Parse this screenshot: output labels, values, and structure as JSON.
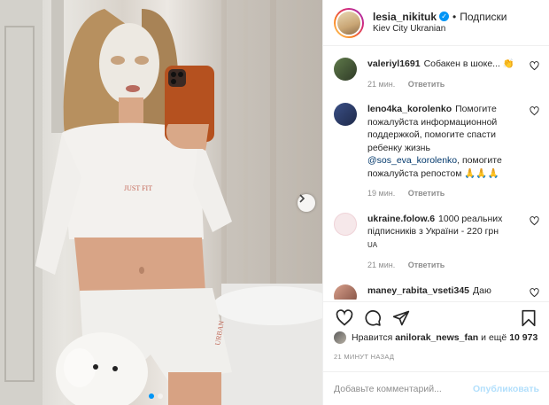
{
  "header": {
    "username": "lesia_nikituk",
    "separator": "•",
    "follow_label": "Подписки",
    "location": "Kiev City Ukranian"
  },
  "comments": [
    {
      "user": "valeriyl1691",
      "text": "Собакен в шоке...",
      "emoji": "👏",
      "time": "21 мин.",
      "reply": "Ответить",
      "avatar_color": "#4a5a3a"
    },
    {
      "user": "leno4ka_korolenko",
      "text_before": "Помогите пожалуйста информационной поддержкой, помогите спасти ребенку жизнь",
      "mention": "@sos_eva_korolenko",
      "text_after": ", помогите пожалуйста репостом",
      "emoji": "🙏🙏🙏",
      "time": "19 мин.",
      "reply": "Ответить",
      "avatar_color": "#2c3e66"
    },
    {
      "user": "ukraine.folow.6",
      "text": "1000 реальних підписників з України - 220 грн",
      "flag": "UA",
      "time": "21 мин.",
      "reply": "Ответить",
      "avatar_color": "#f3e3e6"
    },
    {
      "user": "maney_rabita_vseti345",
      "text": "Даю",
      "avatar_color": "#c98b7a"
    }
  ],
  "likes": {
    "prefix": "Нравится",
    "user": "anilorak_news_fan",
    "middle": "и ещё",
    "count": "10 973"
  },
  "timestamp": "21 МИНУТ НАЗАД",
  "add_comment": {
    "placeholder": "Добавьте комментарий...",
    "publish_label": "Опубликовать"
  },
  "icons": {
    "like": "heart-icon",
    "comment": "comment-icon",
    "share": "share-icon",
    "save": "bookmark-icon",
    "next": "chevron-right-icon"
  },
  "colors": {
    "accent": "#0095f6",
    "link": "#00376b",
    "muted": "#8e8e8e",
    "publish_disabled": "#b2dffc"
  }
}
